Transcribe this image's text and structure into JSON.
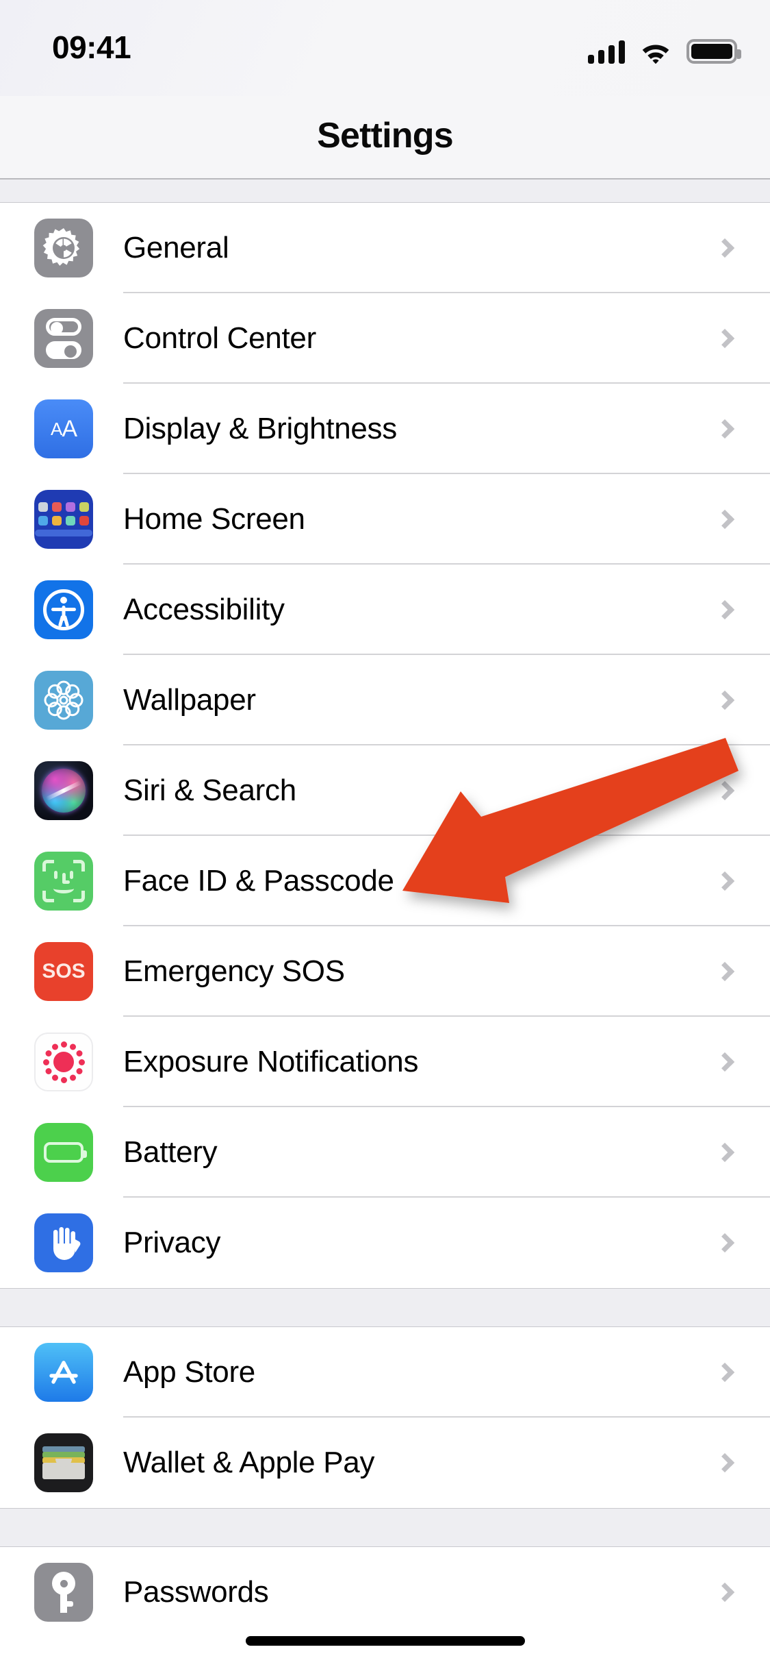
{
  "status_bar": {
    "time": "09:41",
    "cellular_icon": "cellular-signal-icon",
    "cellular_bars": 4,
    "wifi_icon": "wifi-icon",
    "battery_icon": "battery-full-icon"
  },
  "nav": {
    "title": "Settings"
  },
  "groups": [
    {
      "id": "system-group",
      "rows": [
        {
          "label": "General",
          "icon": "gear-icon",
          "icon_color": "#8E8E93"
        },
        {
          "label": "Control Center",
          "icon": "control-center-toggles-icon",
          "icon_color": "#8E8E93"
        },
        {
          "label": "Display & Brightness",
          "icon": "display-brightness-aa-icon",
          "icon_color": "#2F6FE4"
        },
        {
          "label": "Home Screen",
          "icon": "home-screen-grid-icon",
          "icon_color": "#1F3BB3"
        },
        {
          "label": "Accessibility",
          "icon": "accessibility-person-icon",
          "icon_color": "#1273E8"
        },
        {
          "label": "Wallpaper",
          "icon": "wallpaper-flower-icon",
          "icon_color": "#57A8D6"
        },
        {
          "label": "Siri & Search",
          "icon": "siri-orb-icon",
          "icon_color": "#0B0D16"
        },
        {
          "label": "Face ID & Passcode",
          "icon": "face-id-icon",
          "icon_color": "#55CC66"
        },
        {
          "label": "Emergency SOS",
          "icon": "emergency-sos-icon",
          "icon_color": "#E8412C"
        },
        {
          "label": "Exposure Notifications",
          "icon": "exposure-notifications-icon",
          "icon_color": "#EE2F56"
        },
        {
          "label": "Battery",
          "icon": "battery-icon",
          "icon_color": "#4CD04C"
        },
        {
          "label": "Privacy",
          "icon": "privacy-hand-icon",
          "icon_color": "#2F6FE4"
        }
      ]
    },
    {
      "id": "store-group",
      "rows": [
        {
          "label": "App Store",
          "icon": "app-store-icon",
          "icon_color": "#1E7AE8"
        },
        {
          "label": "Wallet & Apple Pay",
          "icon": "wallet-icon",
          "icon_color": "#1C1C1E"
        }
      ]
    },
    {
      "id": "passwords-group",
      "rows": [
        {
          "label": "Passwords",
          "icon": "passwords-key-icon",
          "icon_color": "#8E8E93"
        }
      ]
    }
  ],
  "annotation": {
    "type": "arrow",
    "color": "#E4401F",
    "points_to": "Face ID & Passcode"
  },
  "chevron_color": "#C2C2C6",
  "home_indicator": "home-indicator"
}
